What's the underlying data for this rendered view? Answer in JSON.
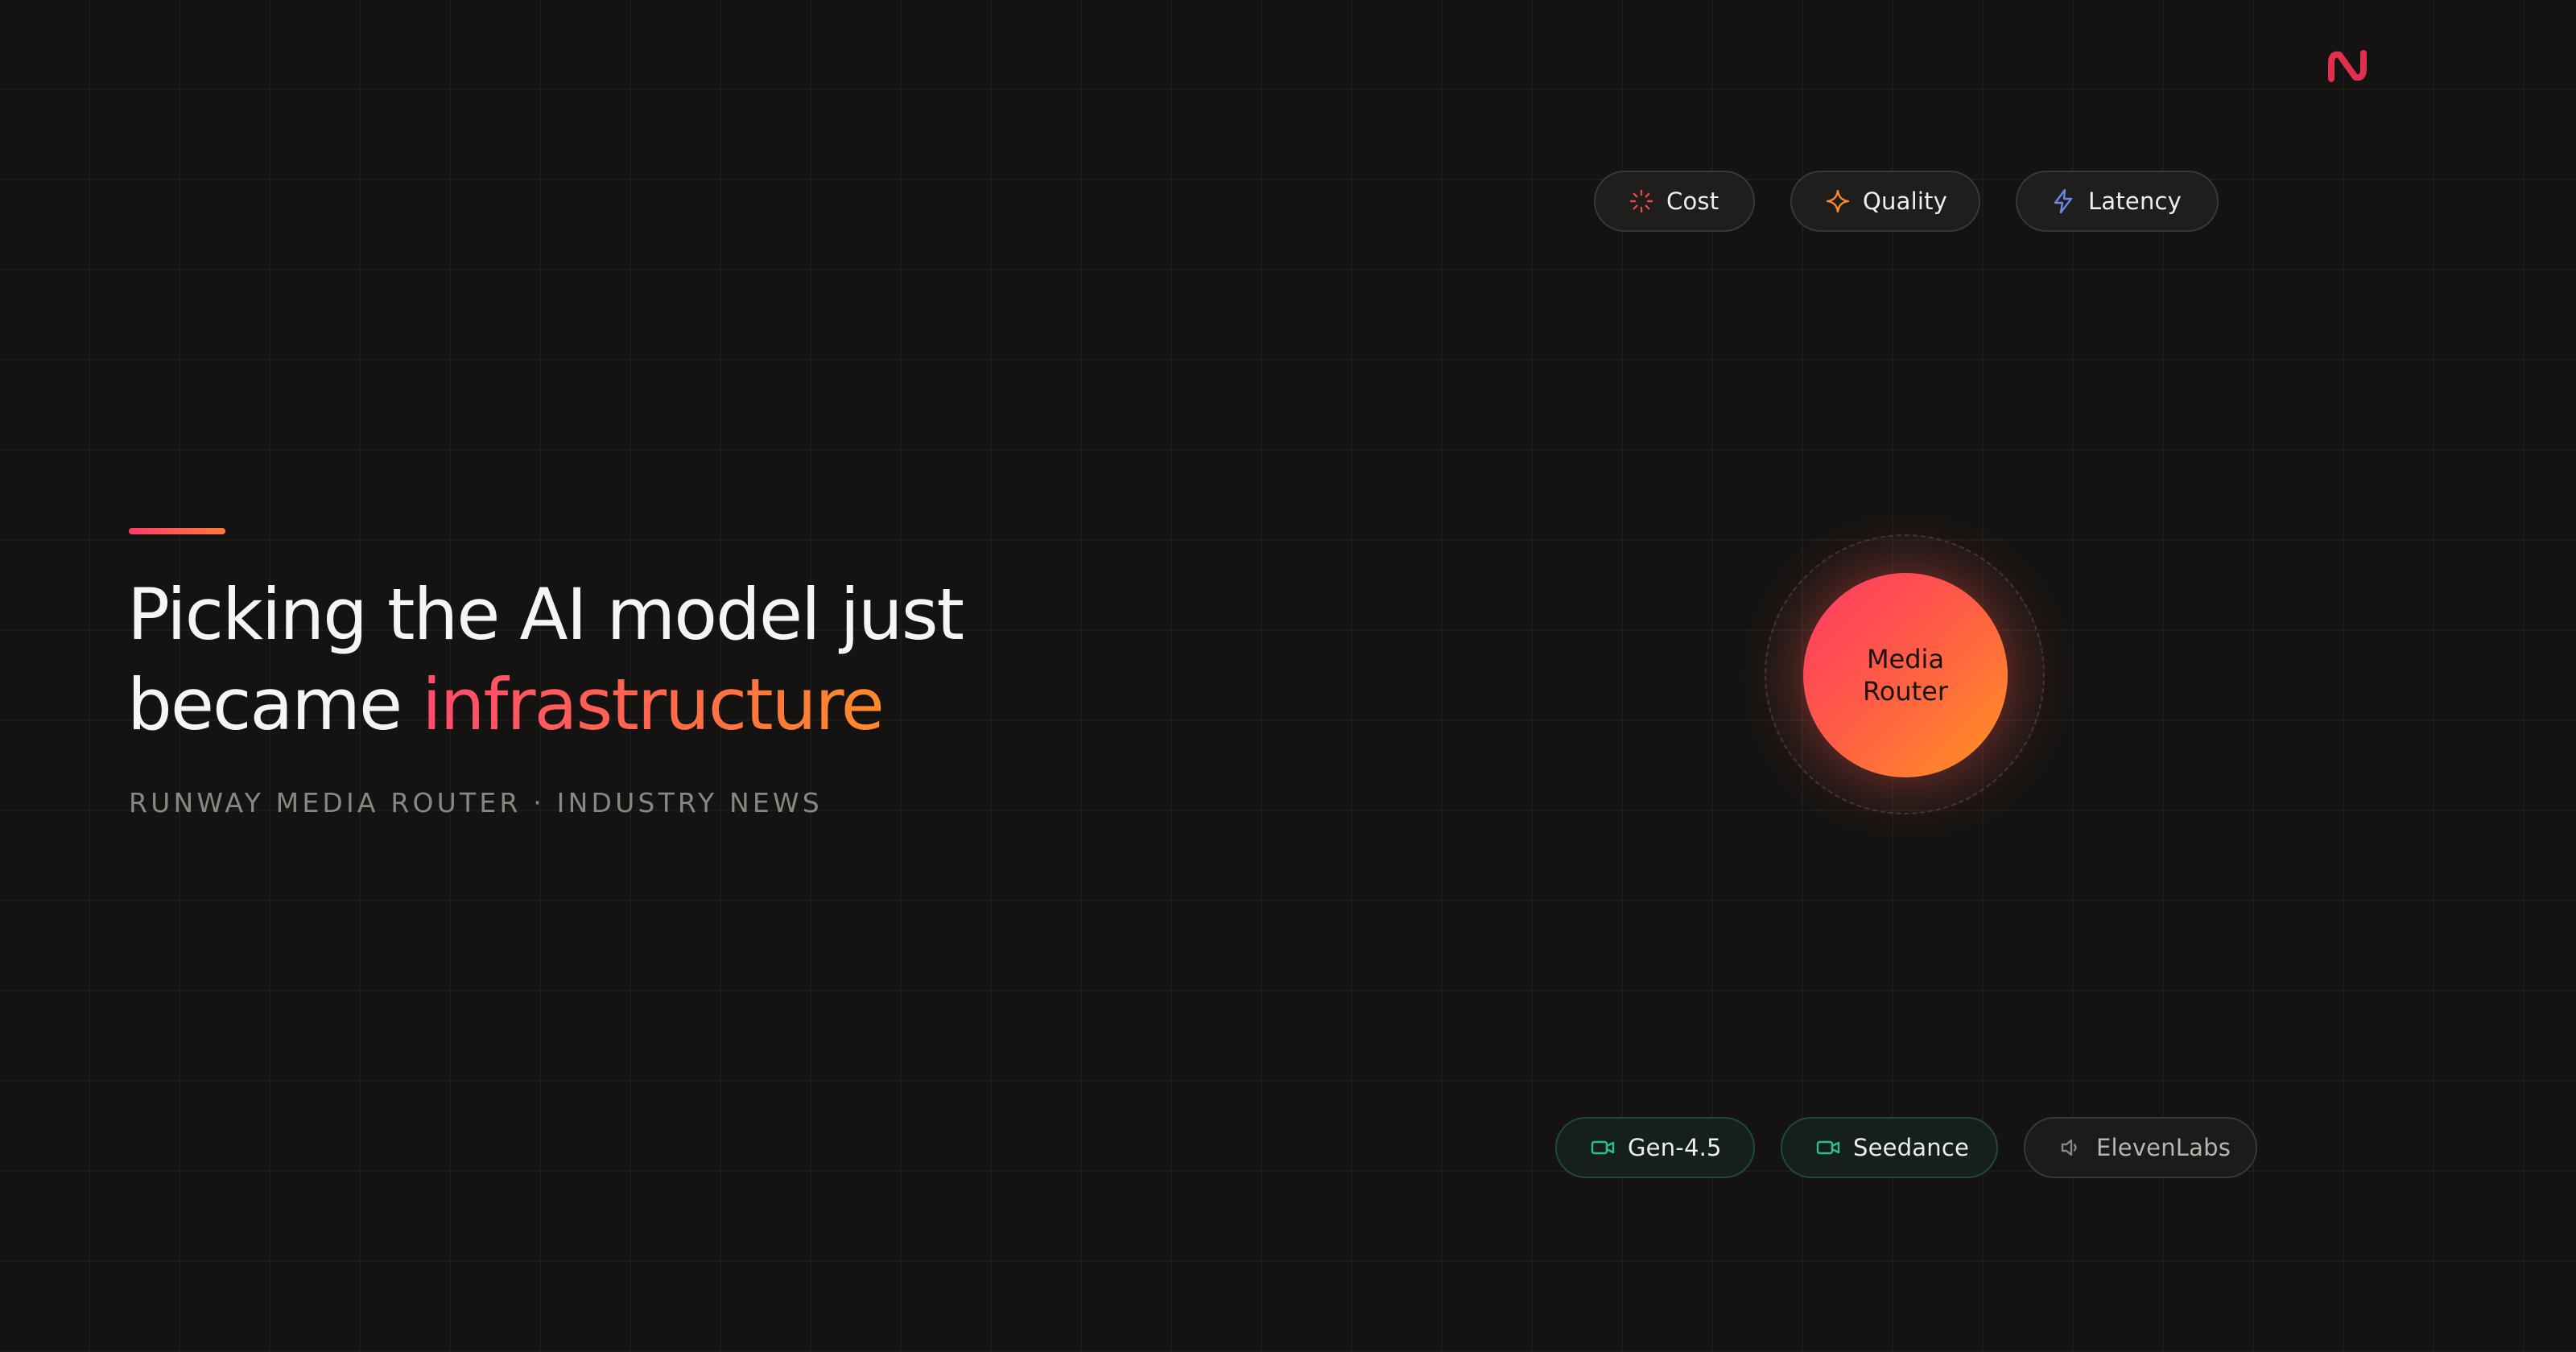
{
  "brand": {
    "logo_icon": "runway-logo-icon",
    "color": "#e0304e"
  },
  "criteria": [
    {
      "label": "Cost",
      "icon": "dashed-spinner-icon",
      "color": "#e8484a"
    },
    {
      "label": "Quality",
      "icon": "sparkle-icon",
      "color": "#ff8a2a"
    },
    {
      "label": "Latency",
      "icon": "lightning-bolt-icon",
      "color": "#6a86e8"
    }
  ],
  "hero": {
    "headline_line1": "Picking the AI model just",
    "headline_line2_prefix": "became ",
    "headline_highlight": "infrastructure",
    "subline": "RUNWAY MEDIA ROUTER · INDUSTRY NEWS"
  },
  "router": {
    "label_line1": "Media",
    "label_line2": "Router"
  },
  "models": [
    {
      "label": "Gen-4.5",
      "icon": "video-camera-icon",
      "icon_color": "#2fbf86"
    },
    {
      "label": "Seedance",
      "icon": "video-camera-icon",
      "icon_color": "#2fbf86"
    },
    {
      "label": "ElevenLabs",
      "icon": "speaker-icon",
      "icon_color": "#8a8783"
    }
  ],
  "colors": {
    "background": "#141311",
    "accent_start": "#ff3d6a",
    "accent_end": "#ff8a2a"
  }
}
